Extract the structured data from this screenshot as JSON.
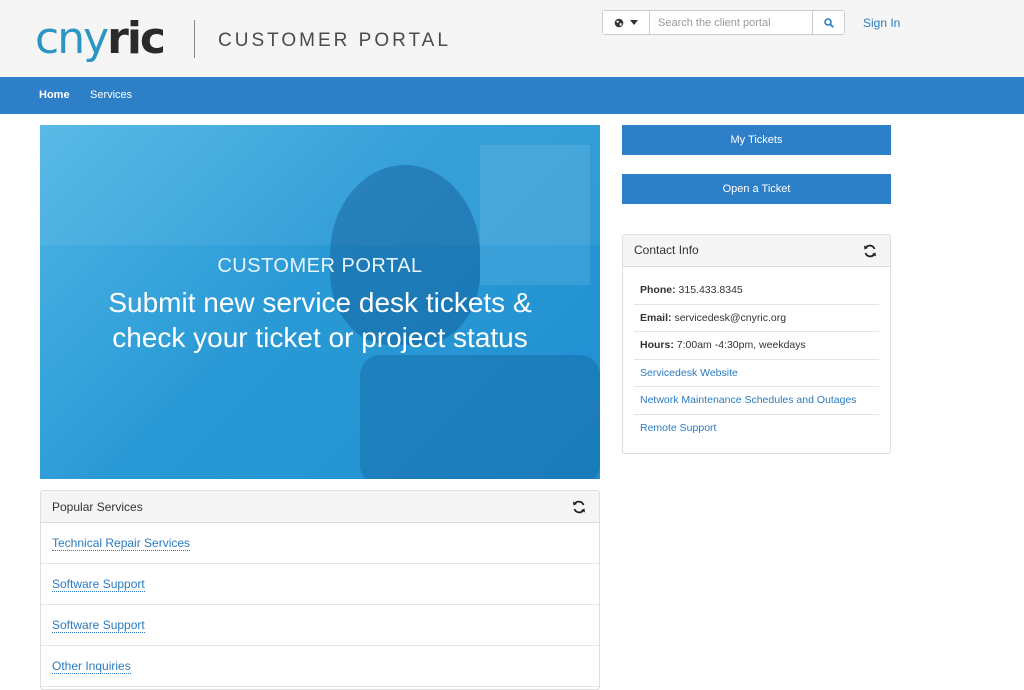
{
  "header": {
    "logo_part1": "cny",
    "logo_part2": "ric",
    "portal_title": "CUSTOMER PORTAL",
    "search_placeholder": "Search the client portal",
    "sign_in": "Sign In",
    "language_icon": "globe-icon",
    "search_icon": "search-icon"
  },
  "nav": {
    "home": "Home",
    "services": "Services"
  },
  "hero": {
    "kicker": "CUSTOMER PORTAL",
    "line1": "Submit new service desk tickets &",
    "line2": "check your ticket or project status"
  },
  "popular_services": {
    "title": "Popular Services",
    "items": [
      "Technical Repair Services",
      "Software Support",
      "Software Support",
      "Other Inquiries"
    ]
  },
  "actions": {
    "my_tickets": "My Tickets",
    "open_ticket": "Open a Ticket"
  },
  "contact": {
    "title": "Contact Info",
    "phone_label": "Phone:",
    "phone_value": "315.433.8345",
    "email_label": "Email:",
    "email_value": "servicedesk@cnyric.org",
    "hours_label": "Hours:",
    "hours_value": "7:00am -4:30pm, weekdays",
    "links": [
      "Servicedesk Website",
      "Network Maintenance Schedules and Outages",
      "Remote Support"
    ]
  },
  "colors": {
    "brand_blue": "#2d7fc8",
    "link_blue": "#2a7bc1",
    "logo_teal": "#2b95c3"
  }
}
